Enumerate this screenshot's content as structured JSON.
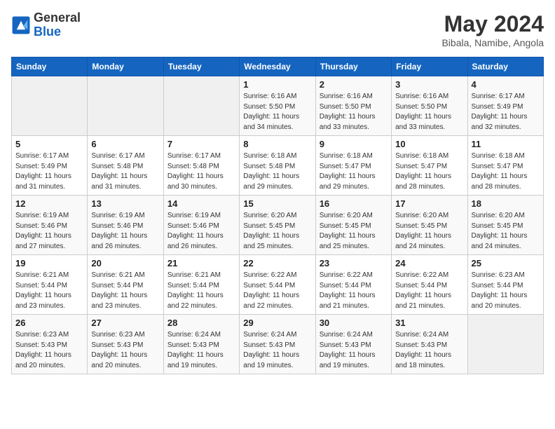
{
  "header": {
    "logo_line1": "General",
    "logo_line2": "Blue",
    "month": "May 2024",
    "location": "Bibala, Namibe, Angola"
  },
  "weekdays": [
    "Sunday",
    "Monday",
    "Tuesday",
    "Wednesday",
    "Thursday",
    "Friday",
    "Saturday"
  ],
  "weeks": [
    [
      {
        "day": "",
        "info": ""
      },
      {
        "day": "",
        "info": ""
      },
      {
        "day": "",
        "info": ""
      },
      {
        "day": "1",
        "info": "Sunrise: 6:16 AM\nSunset: 5:50 PM\nDaylight: 11 hours and 34 minutes."
      },
      {
        "day": "2",
        "info": "Sunrise: 6:16 AM\nSunset: 5:50 PM\nDaylight: 11 hours and 33 minutes."
      },
      {
        "day": "3",
        "info": "Sunrise: 6:16 AM\nSunset: 5:50 PM\nDaylight: 11 hours and 33 minutes."
      },
      {
        "day": "4",
        "info": "Sunrise: 6:17 AM\nSunset: 5:49 PM\nDaylight: 11 hours and 32 minutes."
      }
    ],
    [
      {
        "day": "5",
        "info": "Sunrise: 6:17 AM\nSunset: 5:49 PM\nDaylight: 11 hours and 31 minutes."
      },
      {
        "day": "6",
        "info": "Sunrise: 6:17 AM\nSunset: 5:48 PM\nDaylight: 11 hours and 31 minutes."
      },
      {
        "day": "7",
        "info": "Sunrise: 6:17 AM\nSunset: 5:48 PM\nDaylight: 11 hours and 30 minutes."
      },
      {
        "day": "8",
        "info": "Sunrise: 6:18 AM\nSunset: 5:48 PM\nDaylight: 11 hours and 29 minutes."
      },
      {
        "day": "9",
        "info": "Sunrise: 6:18 AM\nSunset: 5:47 PM\nDaylight: 11 hours and 29 minutes."
      },
      {
        "day": "10",
        "info": "Sunrise: 6:18 AM\nSunset: 5:47 PM\nDaylight: 11 hours and 28 minutes."
      },
      {
        "day": "11",
        "info": "Sunrise: 6:18 AM\nSunset: 5:47 PM\nDaylight: 11 hours and 28 minutes."
      }
    ],
    [
      {
        "day": "12",
        "info": "Sunrise: 6:19 AM\nSunset: 5:46 PM\nDaylight: 11 hours and 27 minutes."
      },
      {
        "day": "13",
        "info": "Sunrise: 6:19 AM\nSunset: 5:46 PM\nDaylight: 11 hours and 26 minutes."
      },
      {
        "day": "14",
        "info": "Sunrise: 6:19 AM\nSunset: 5:46 PM\nDaylight: 11 hours and 26 minutes."
      },
      {
        "day": "15",
        "info": "Sunrise: 6:20 AM\nSunset: 5:45 PM\nDaylight: 11 hours and 25 minutes."
      },
      {
        "day": "16",
        "info": "Sunrise: 6:20 AM\nSunset: 5:45 PM\nDaylight: 11 hours and 25 minutes."
      },
      {
        "day": "17",
        "info": "Sunrise: 6:20 AM\nSunset: 5:45 PM\nDaylight: 11 hours and 24 minutes."
      },
      {
        "day": "18",
        "info": "Sunrise: 6:20 AM\nSunset: 5:45 PM\nDaylight: 11 hours and 24 minutes."
      }
    ],
    [
      {
        "day": "19",
        "info": "Sunrise: 6:21 AM\nSunset: 5:44 PM\nDaylight: 11 hours and 23 minutes."
      },
      {
        "day": "20",
        "info": "Sunrise: 6:21 AM\nSunset: 5:44 PM\nDaylight: 11 hours and 23 minutes."
      },
      {
        "day": "21",
        "info": "Sunrise: 6:21 AM\nSunset: 5:44 PM\nDaylight: 11 hours and 22 minutes."
      },
      {
        "day": "22",
        "info": "Sunrise: 6:22 AM\nSunset: 5:44 PM\nDaylight: 11 hours and 22 minutes."
      },
      {
        "day": "23",
        "info": "Sunrise: 6:22 AM\nSunset: 5:44 PM\nDaylight: 11 hours and 21 minutes."
      },
      {
        "day": "24",
        "info": "Sunrise: 6:22 AM\nSunset: 5:44 PM\nDaylight: 11 hours and 21 minutes."
      },
      {
        "day": "25",
        "info": "Sunrise: 6:23 AM\nSunset: 5:44 PM\nDaylight: 11 hours and 20 minutes."
      }
    ],
    [
      {
        "day": "26",
        "info": "Sunrise: 6:23 AM\nSunset: 5:43 PM\nDaylight: 11 hours and 20 minutes."
      },
      {
        "day": "27",
        "info": "Sunrise: 6:23 AM\nSunset: 5:43 PM\nDaylight: 11 hours and 20 minutes."
      },
      {
        "day": "28",
        "info": "Sunrise: 6:24 AM\nSunset: 5:43 PM\nDaylight: 11 hours and 19 minutes."
      },
      {
        "day": "29",
        "info": "Sunrise: 6:24 AM\nSunset: 5:43 PM\nDaylight: 11 hours and 19 minutes."
      },
      {
        "day": "30",
        "info": "Sunrise: 6:24 AM\nSunset: 5:43 PM\nDaylight: 11 hours and 19 minutes."
      },
      {
        "day": "31",
        "info": "Sunrise: 6:24 AM\nSunset: 5:43 PM\nDaylight: 11 hours and 18 minutes."
      },
      {
        "day": "",
        "info": ""
      }
    ]
  ]
}
